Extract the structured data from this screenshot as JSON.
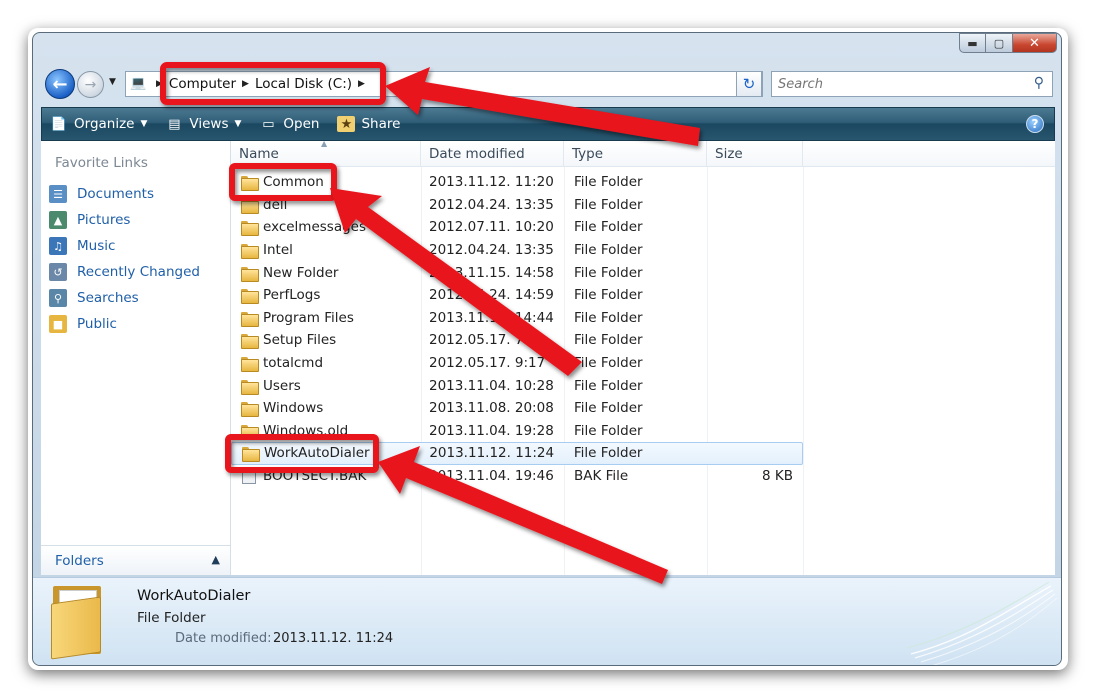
{
  "navigation": {
    "breadcrumb": [
      "Computer",
      "Local Disk (C:)"
    ]
  },
  "search": {
    "placeholder": "Search"
  },
  "toolbar": {
    "organize": "Organize",
    "views": "Views",
    "open": "Open",
    "share": "Share"
  },
  "sidebar": {
    "heading": "Favorite Links",
    "items": [
      {
        "label": "Documents",
        "icon": "documents-icon"
      },
      {
        "label": "Pictures",
        "icon": "pictures-icon"
      },
      {
        "label": "Music",
        "icon": "music-icon"
      },
      {
        "label": "Recently Changed",
        "icon": "recently-changed-icon"
      },
      {
        "label": "Searches",
        "icon": "searches-icon"
      },
      {
        "label": "Public",
        "icon": "public-folder-icon"
      }
    ],
    "folders_label": "Folders"
  },
  "columns": [
    "Name",
    "Date modified",
    "Type",
    "Size"
  ],
  "files": [
    {
      "name": "Common",
      "date": "2013.11.12. 11:20",
      "type": "File Folder",
      "size": "",
      "kind": "folder"
    },
    {
      "name": "dell",
      "date": "2012.04.24. 13:35",
      "type": "File Folder",
      "size": "",
      "kind": "folder"
    },
    {
      "name": "excelmessages",
      "date": "2012.07.11. 10:20",
      "type": "File Folder",
      "size": "",
      "kind": "folder"
    },
    {
      "name": "Intel",
      "date": "2012.04.24. 13:35",
      "type": "File Folder",
      "size": "",
      "kind": "folder"
    },
    {
      "name": "New Folder",
      "date": "2013.11.15. 14:58",
      "type": "File Folder",
      "size": "",
      "kind": "folder"
    },
    {
      "name": "PerfLogs",
      "date": "2012.04.24. 14:59",
      "type": "File Folder",
      "size": "",
      "kind": "folder"
    },
    {
      "name": "Program Files",
      "date": "2013.11.15. 14:44",
      "type": "File Folder",
      "size": "",
      "kind": "folder"
    },
    {
      "name": "Setup Files",
      "date": "2012.05.17. 7:58",
      "type": "File Folder",
      "size": "",
      "kind": "folder"
    },
    {
      "name": "totalcmd",
      "date": "2012.05.17. 9:17",
      "type": "File Folder",
      "size": "",
      "kind": "folder"
    },
    {
      "name": "Users",
      "date": "2013.11.04. 10:28",
      "type": "File Folder",
      "size": "",
      "kind": "folder"
    },
    {
      "name": "Windows",
      "date": "2013.11.08. 20:08",
      "type": "File Folder",
      "size": "",
      "kind": "folder"
    },
    {
      "name": "Windows.old",
      "date": "2013.11.04. 19:28",
      "type": "File Folder",
      "size": "",
      "kind": "folder"
    },
    {
      "name": "WorkAutoDialer",
      "date": "2013.11.12. 11:24",
      "type": "File Folder",
      "size": "",
      "kind": "folder",
      "selected": true
    },
    {
      "name": "BOOTSECT.BAK",
      "date": "2013.11.04. 19:46",
      "type": "BAK File",
      "size": "8 KB",
      "kind": "file"
    }
  ],
  "details": {
    "name": "WorkAutoDialer",
    "type": "File Folder",
    "date_label": "Date modified:",
    "date_value": "2013.11.12. 11:24"
  },
  "colors": {
    "annotation": "#e8131b",
    "link": "#1f5fa8",
    "command_bar": "#2f5d77"
  }
}
